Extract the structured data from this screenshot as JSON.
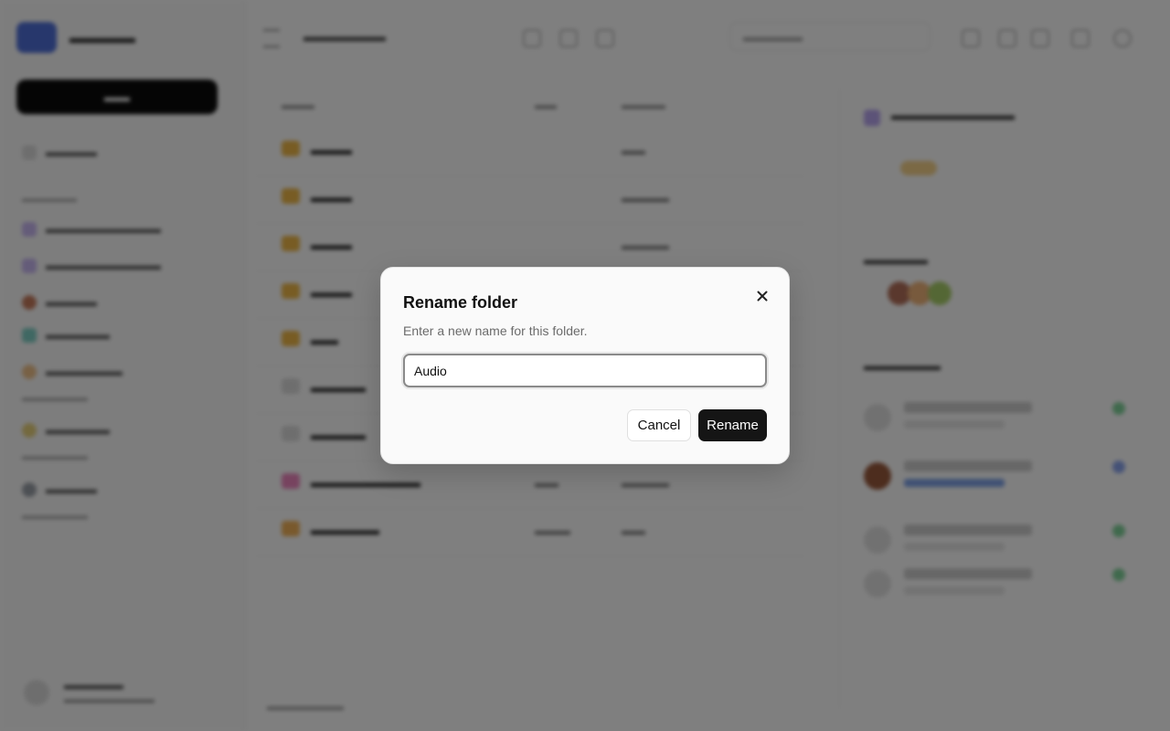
{
  "dialog": {
    "title": "Rename folder",
    "description": "Enter a new name for this folder.",
    "input_value": "Audio",
    "cancel_label": "Cancel",
    "rename_label": "Rename",
    "close_icon": "close-icon"
  },
  "colors": {
    "overlay": "rgba(0,0,0,0.5)",
    "primary_button": "#151515",
    "folder_icon": "#f0b948",
    "accent": "#4f6fd8"
  }
}
